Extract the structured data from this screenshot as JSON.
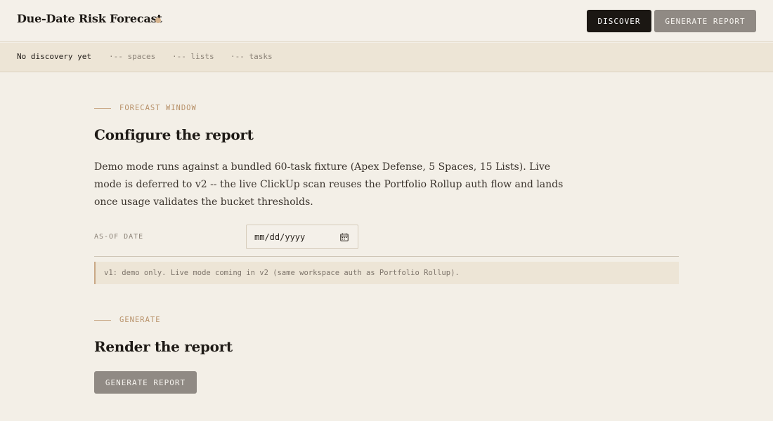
{
  "header": {
    "title": "Due-Date Risk Forecast",
    "discover_label": "DISCOVER",
    "generate_label": "GENERATE REPORT"
  },
  "status": {
    "main": "No discovery yet",
    "spaces": "·-- spaces",
    "lists": "·-- lists",
    "tasks": "·-- tasks"
  },
  "forecast": {
    "eyebrow": "FORECAST WINDOW",
    "heading": "Configure the report",
    "description": "Demo mode runs against a bundled 60-task fixture (Apex Defense, 5 Spaces, 15 Lists). Live mode is deferred to v2 -- the live ClickUp scan reuses the Portfolio Rollup auth flow and lands once usage validates the bucket thresholds.",
    "as_of_label": "AS-OF DATE",
    "date_placeholder": "mm/dd/yyyy",
    "notice": "v1: demo only. Live mode coming in v2 (same workspace auth as Portfolio Rollup)."
  },
  "generate": {
    "eyebrow": "GENERATE",
    "heading": "Render the report",
    "button_label": "GENERATE REPORT"
  },
  "colors": {
    "background": "#f3efe7",
    "accent": "#c9a886",
    "primary_button": "#1b1713",
    "disabled_button": "#908a84"
  },
  "icons": {
    "date_picker": "calendar-icon",
    "status_indicator": "status-dot"
  }
}
